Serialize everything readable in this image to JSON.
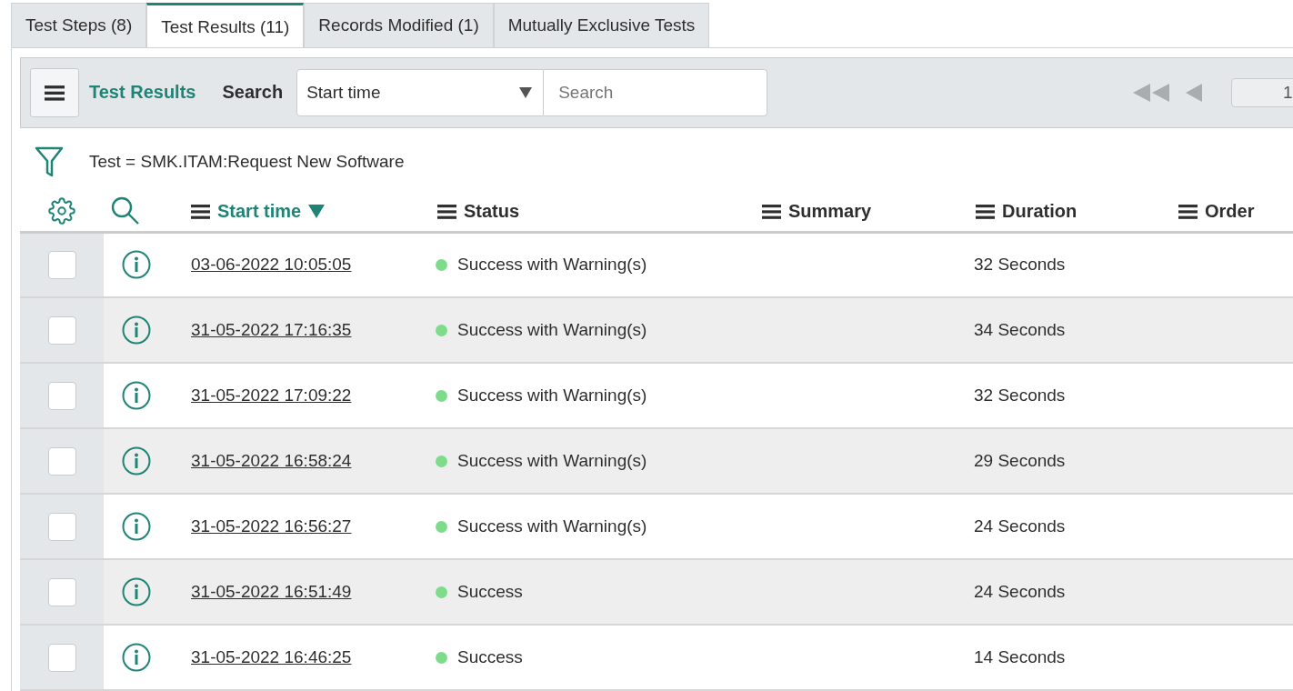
{
  "tabs": [
    {
      "label": "Test Steps (8)",
      "selected": false
    },
    {
      "label": "Test Results (11)",
      "selected": true
    },
    {
      "label": "Records Modified (1)",
      "selected": false
    },
    {
      "label": "Mutually Exclusive Tests",
      "selected": false
    }
  ],
  "toolbar": {
    "title": "Test Results",
    "search_label": "Search",
    "search_field": "Start time",
    "search": {
      "placeholder": "Search"
    },
    "page": "1"
  },
  "filter": "Test = SMK.ITAM:Request New Software",
  "columns": [
    {
      "label": "Start time",
      "sorted": true
    },
    {
      "label": "Status",
      "sorted": false
    },
    {
      "label": "Summary",
      "sorted": false
    },
    {
      "label": "Duration",
      "sorted": false
    },
    {
      "label": "Order",
      "sorted": false
    }
  ],
  "rows": [
    {
      "checked": false,
      "start_time": "03-06-2022 10:05:05",
      "status": "Success with Warning(s)",
      "duration": "32 Seconds"
    },
    {
      "checked": false,
      "start_time": "31-05-2022 17:16:35",
      "status": "Success with Warning(s)",
      "duration": "34 Seconds"
    },
    {
      "checked": false,
      "start_time": "31-05-2022 17:09:22",
      "status": "Success with Warning(s)",
      "duration": "32 Seconds"
    },
    {
      "checked": false,
      "start_time": "31-05-2022 16:58:24",
      "status": "Success with Warning(s)",
      "duration": "29 Seconds"
    },
    {
      "checked": false,
      "start_time": "31-05-2022 16:56:27",
      "status": "Success with Warning(s)",
      "duration": "24 Seconds"
    },
    {
      "checked": false,
      "start_time": "31-05-2022 16:51:49",
      "status": "Success",
      "duration": "24 Seconds"
    },
    {
      "checked": false,
      "start_time": "31-05-2022 16:46:25",
      "status": "Success",
      "duration": "14 Seconds"
    }
  ]
}
